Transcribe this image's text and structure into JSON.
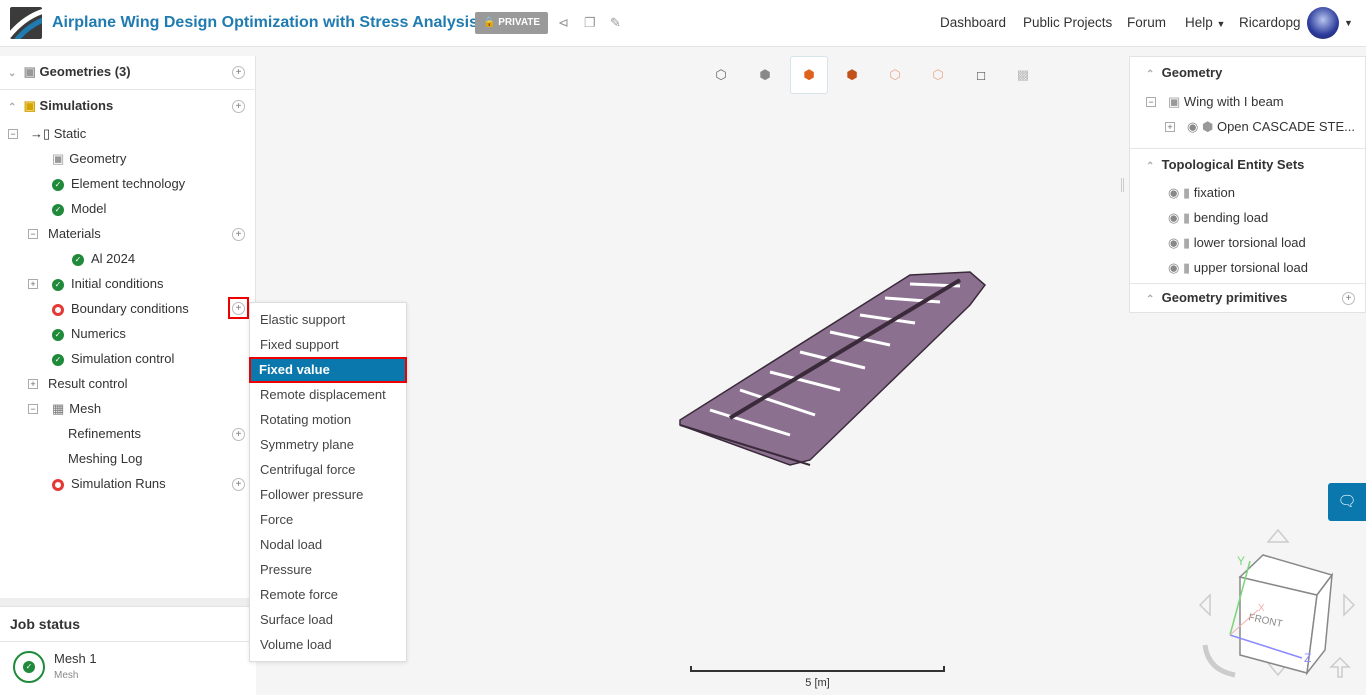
{
  "header": {
    "title": "Airplane Wing Design Optimization with Stress Analysis",
    "private_label": "PRIVATE",
    "nav": [
      "Dashboard",
      "Public Projects",
      "Forum",
      "Help",
      "Ricardopg"
    ]
  },
  "tree": {
    "geometries": "Geometries (3)",
    "simulations": "Simulations",
    "static": "Static",
    "items": [
      "Geometry",
      "Element technology",
      "Model",
      "Materials",
      "Al 2024",
      "Initial conditions",
      "Boundary conditions",
      "Numerics",
      "Simulation control",
      "Result control",
      "Mesh",
      "Refinements",
      "Meshing Log",
      "Simulation Runs"
    ]
  },
  "menu": {
    "items": [
      "Elastic support",
      "Fixed support",
      "Fixed value",
      "Remote displacement",
      "Rotating motion",
      "Symmetry plane",
      "Centrifugal force",
      "Follower pressure",
      "Force",
      "Nodal load",
      "Pressure",
      "Remote force",
      "Surface load",
      "Volume load"
    ],
    "selected": "Fixed value"
  },
  "job": {
    "title": "Job status",
    "name": "Mesh 1",
    "type": "Mesh"
  },
  "right": {
    "geometry": "Geometry",
    "wing": "Wing with I beam",
    "part": "Open CASCADE STE...",
    "tes": "Topological Entity Sets",
    "sets": [
      "fixation",
      "bending load",
      "lower torsional load",
      "upper torsional load"
    ],
    "primitives": "Geometry primitives"
  },
  "viewer": {
    "scale": "5 [m]",
    "cube_front": "FRONT",
    "axis_x": "X",
    "axis_y": "Y",
    "axis_z": "Z"
  },
  "colors": {
    "accent": "#0a78ad",
    "ok": "#1e8a3a",
    "error": "#e53935",
    "wing": "#8c7090"
  }
}
